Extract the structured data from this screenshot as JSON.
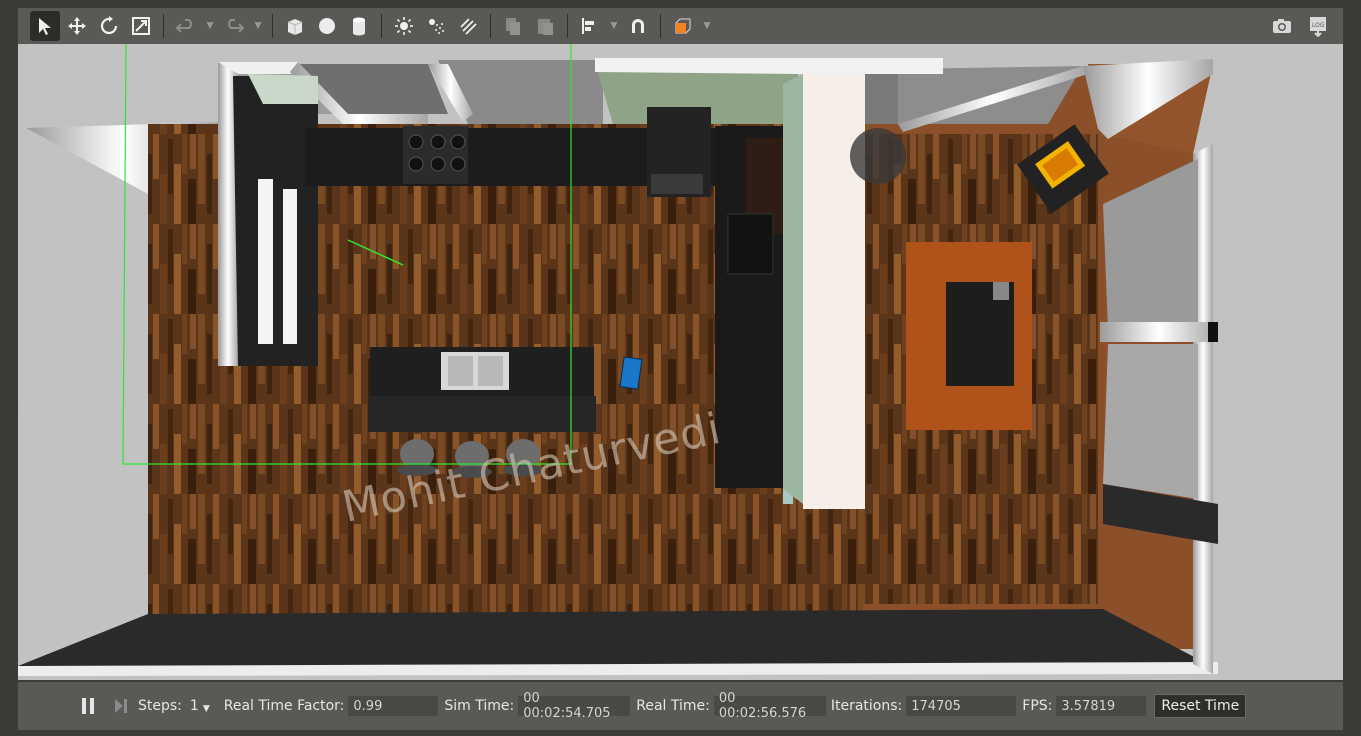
{
  "toolbar": {
    "tools": [
      "select-mode",
      "translate-mode",
      "rotate-mode",
      "scale-mode",
      "undo",
      "redo",
      "box-shape",
      "sphere-shape",
      "cylinder-shape",
      "point-light",
      "spot-light",
      "directional-light",
      "copy",
      "paste",
      "align",
      "snap",
      "view-angle"
    ],
    "right_tools": [
      "screenshot",
      "log"
    ]
  },
  "scene": {
    "watermark": "Mohit Chaturvedi"
  },
  "bottom": {
    "steps_label": "Steps:",
    "steps_value": "1",
    "rtf_label": "Real Time Factor:",
    "rtf_value": "0.99",
    "sim_time_label": "Sim Time:",
    "sim_time_value": "00 00:02:54.705",
    "real_time_label": "Real Time:",
    "real_time_value": "00 00:02:56.576",
    "iterations_label": "Iterations:",
    "iterations_value": "174705",
    "fps_label": "FPS:",
    "fps_value": "3.57819",
    "reset_label": "Reset Time"
  },
  "colors": {
    "toolbar_bg": "#5a5955",
    "active_tool": "#2d2c29",
    "accent_orange": "#f58220",
    "grid_green": "#2ee82e"
  }
}
